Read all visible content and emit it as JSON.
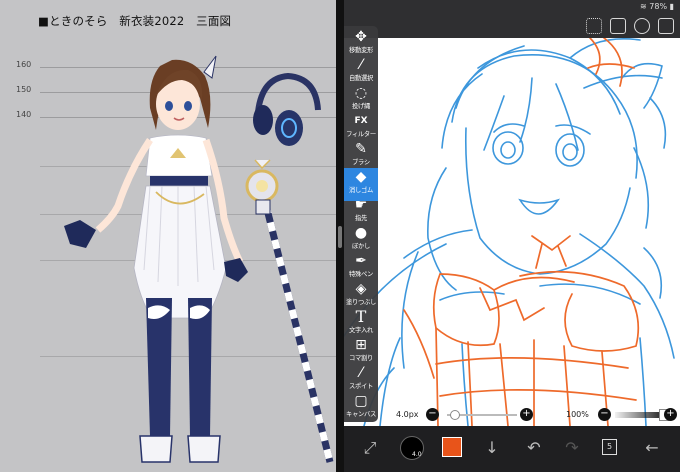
{
  "reference_sheet": {
    "title": "■ときのそら　新衣装2022　三面図",
    "height_marks": [
      "160",
      "150",
      "140"
    ]
  },
  "status_bar": {
    "battery": "78%",
    "icons": [
      "wifi-icon",
      "battery-icon"
    ]
  },
  "toolbar": {
    "tools": [
      {
        "label": "移動変形",
        "icon": "move-icon"
      },
      {
        "label": "自動選択",
        "icon": "magic-wand-icon"
      },
      {
        "label": "投げ縄",
        "icon": "lasso-icon"
      },
      {
        "label": "フィルター",
        "icon": "fx-icon",
        "glyph": "FX"
      },
      {
        "label": "ブラシ",
        "icon": "brush-icon"
      },
      {
        "label": "消しゴム",
        "icon": "eraser-icon",
        "active": true
      },
      {
        "label": "指先",
        "icon": "finger-icon"
      },
      {
        "label": "ぼかし",
        "icon": "blur-icon"
      },
      {
        "label": "特殊ペン",
        "icon": "special-pen-icon"
      },
      {
        "label": "塗りつぶし",
        "icon": "fill-icon"
      },
      {
        "label": "文字入れ",
        "icon": "text-icon",
        "glyph": "T"
      },
      {
        "label": "コマ割り",
        "icon": "frame-divider-icon"
      },
      {
        "label": "スポイト",
        "icon": "eyedropper-icon"
      },
      {
        "label": "キャンバス",
        "icon": "canvas-icon"
      }
    ]
  },
  "brush_strip": {
    "size_label": "4.0px",
    "opacity_label": "100%",
    "minus_glyph": "−",
    "plus_glyph": "+"
  },
  "bottom_bar": {
    "brush_circle_label": "4.0",
    "layer_count": "5"
  },
  "colors": {
    "accent": "#2d86e0",
    "current_color": "#e8541a",
    "sketch_blue": "#3d97dc",
    "sketch_orange": "#ee6a2b"
  }
}
